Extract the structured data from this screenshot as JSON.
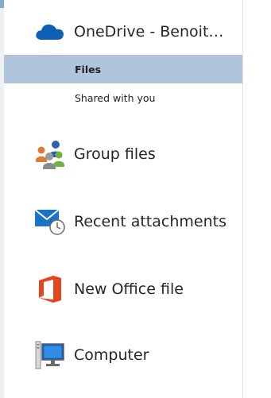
{
  "nav": {
    "onedrive": {
      "label": "OneDrive - Benoit…",
      "icon": "onedrive-cloud-icon"
    },
    "subitems": [
      {
        "label": "Files",
        "selected": true
      },
      {
        "label": "Shared with you",
        "selected": false
      }
    ],
    "group_files": {
      "label": "Group files",
      "icon": "group-people-icon"
    },
    "recent_attachments": {
      "label": "Recent attachments",
      "icon": "mail-clock-icon"
    },
    "new_office_file": {
      "label": "New Office file",
      "icon": "office-logo-icon"
    },
    "computer": {
      "label": "Computer",
      "icon": "computer-monitor-icon"
    }
  },
  "colors": {
    "selected_bg": "#b0c4dc",
    "onedrive_blue": "#0f5fb3",
    "office_red": "#e4461f",
    "mail_blue": "#1a73c7"
  }
}
